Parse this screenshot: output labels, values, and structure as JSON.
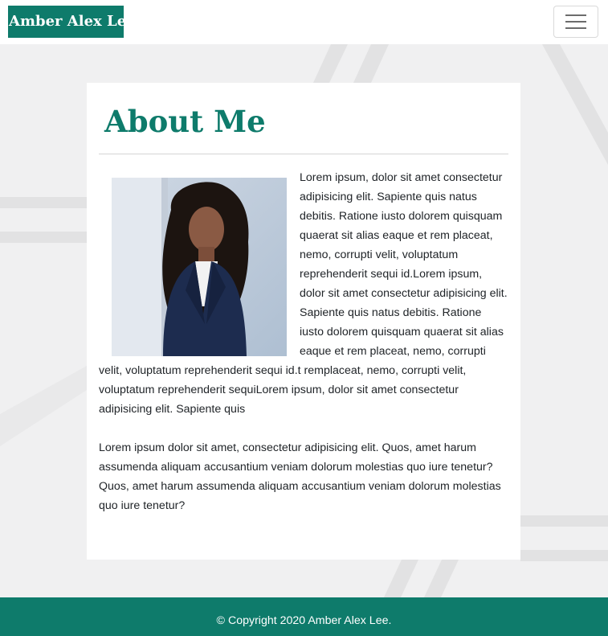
{
  "navbar": {
    "brand": "Amber Alex Lee",
    "toggle_icon": "hamburger-menu-icon"
  },
  "about": {
    "title": "About Me",
    "photo_icon": "portrait-photo",
    "paragraphs": [
      "Lorem ipsum, dolor sit amet consectetur adipisicing elit. Sapiente quis natus debitis. Ratione iusto dolorem quisquam quaerat sit alias eaque et rem placeat, nemo, corrupti velit, voluptatum reprehenderit sequi id.Lorem ipsum, dolor sit amet consectetur adipisicing elit. Sapiente quis natus debitis. Ratione iusto dolorem quisquam quaerat sit alias eaque et rem placeat, nemo, corrupti velit, voluptatum reprehenderit sequi id.t remplaceat, nemo, corrupti velit, voluptatum reprehenderit sequiLorem ipsum, dolor sit amet consectetur adipisicing elit. Sapiente quis",
      "Lorem ipsum dolor sit amet, consectetur adipisicing elit. Quos, amet harum assumenda aliquam accusantium veniam dolorum molestias quo iure tenetur?Quos, amet harum assumenda aliquam accusantium veniam dolorum molestias quo iure tenetur?"
    ]
  },
  "footer": {
    "copyright": "© Copyright 2020 Amber Alex Lee."
  },
  "colors": {
    "brand": "#0e7b6b",
    "background": "#f0f0f1",
    "card": "#ffffff"
  }
}
